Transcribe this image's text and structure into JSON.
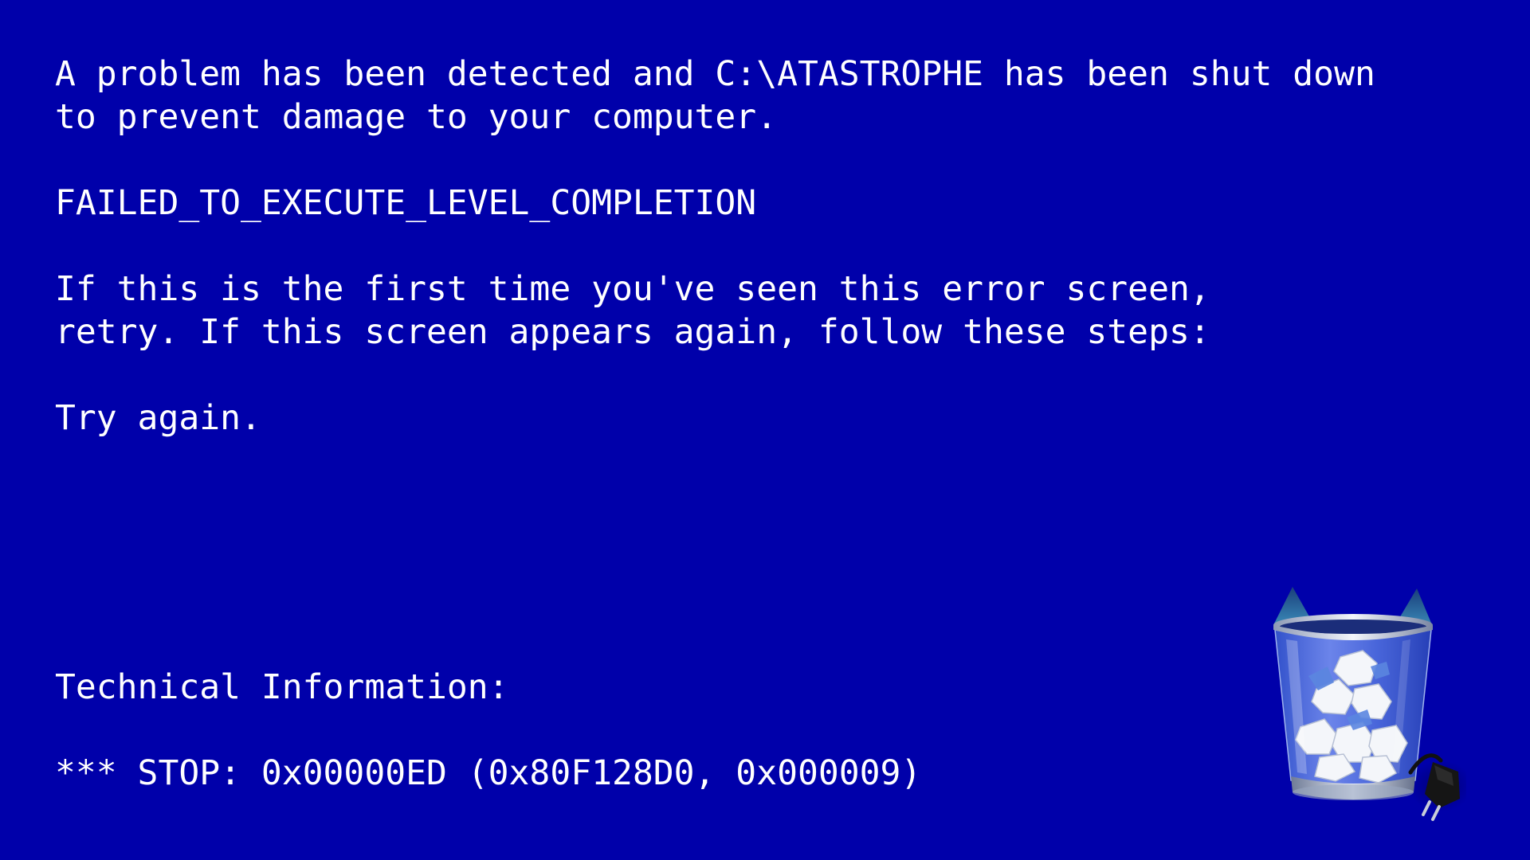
{
  "screen": {
    "background_color": "#0000AA",
    "text_color": "#FFFFFF"
  },
  "message": {
    "line1": "A problem has been detected and C:\\ATASTROPHE has been shut down",
    "line2": "to prevent damage to your computer."
  },
  "error_code": "FAILED_TO_EXECUTE_LEVEL_COMPLETION",
  "help": {
    "line1": "If this is the first time you've seen this error screen,",
    "line2": "retry. If this screen appears again, follow these steps:"
  },
  "instruction": "Try again.",
  "technical": {
    "heading": "Technical Information:",
    "stop_line": "*** STOP: 0x00000ED (0x80F128D0, 0x000009)"
  },
  "icons": {
    "recycle_bin": "recycle-bin-with-cat-ears-icon",
    "plug": "power-plug-icon"
  }
}
